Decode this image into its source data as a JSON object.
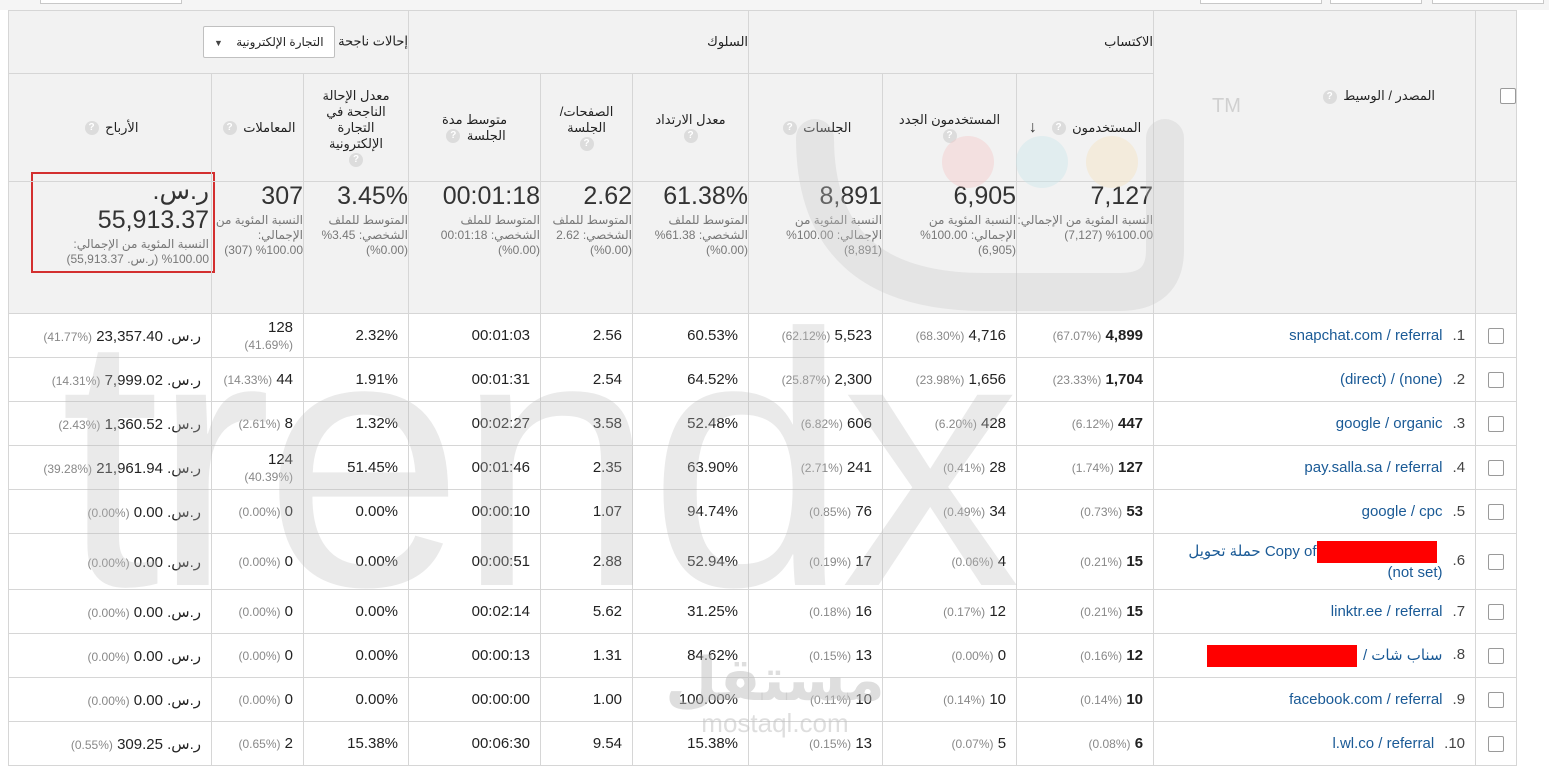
{
  "header": {
    "acquisition": "الاكتساب",
    "behavior": "السلوك",
    "conversions_label": "إحالات ناجحة",
    "ecommerce_dropdown": "التجارة الإلكترونية"
  },
  "columns": {
    "source": "المصدر / الوسيط",
    "users": "المستخدمون",
    "new_users": "المستخدمون الجدد",
    "sessions": "الجلسات",
    "bounce": "معدل الارتداد",
    "pages": "الصفحات/ الجلسة",
    "duration": "متوسط مدة الجلسة",
    "conv_rate": "معدل الإحالة الناجحة في التجارة الإلكترونية",
    "transactions": "المعاملات",
    "revenue": "الأرباح"
  },
  "totals": {
    "users": {
      "value": "7,127",
      "sub": "النسبة المئوية من الإجمالي: 100.00% (7,127)"
    },
    "new_users": {
      "value": "6,905",
      "sub": "النسبة المئوية من الإجمالي: 100.00% (6,905)"
    },
    "sessions": {
      "value": "8,891",
      "sub": "النسبة المئوية من الإجمالي: 100.00% (8,891)"
    },
    "bounce": {
      "value": "61.38%",
      "sub": "المتوسط للملف الشخصي: 61.38% (0.00%)"
    },
    "pages": {
      "value": "2.62",
      "sub": "المتوسط للملف الشخصي: 2.62 (0.00%)"
    },
    "duration": {
      "value": "00:01:18",
      "sub": "المتوسط للملف الشخصي: 00:01:18 (0.00%)"
    },
    "conv_rate": {
      "value": "3.45%",
      "sub": "المتوسط للملف الشخصي: 3.45% (0.00%)"
    },
    "transactions": {
      "value": "307",
      "sub": "النسبة المئوية من الإجمالي: 100.00% (307)"
    },
    "revenue": {
      "value": "ر.س. 55,913.37",
      "sub": "النسبة المئوية من الإجمالي: 100.00% (ر.س. 55,913.37)"
    }
  },
  "rows": [
    {
      "idx": "1.",
      "src": "snapchat.com / referral",
      "users": "4,899",
      "users_pct": "(67.07%)",
      "new": "4,716",
      "new_pct": "(68.30%)",
      "sess": "5,523",
      "sess_pct": "(62.12%)",
      "bounce": "60.53%",
      "pages": "2.56",
      "dur": "00:01:03",
      "conv": "2.32%",
      "tx": "128",
      "tx_pct": "(41.69%)",
      "rev": "ر.س. 23,357.40",
      "rev_pct": "(41.77%)"
    },
    {
      "idx": "2.",
      "src": "(none) / (direct)",
      "users": "1,704",
      "users_pct": "(23.33%)",
      "new": "1,656",
      "new_pct": "(23.98%)",
      "sess": "2,300",
      "sess_pct": "(25.87%)",
      "bounce": "64.52%",
      "pages": "2.54",
      "dur": "00:01:31",
      "conv": "1.91%",
      "tx": "44",
      "tx_pct": "(14.33%)",
      "rev": "ر.س. 7,999.02",
      "rev_pct": "(14.31%)"
    },
    {
      "idx": "3.",
      "src": "google / organic",
      "users": "447",
      "users_pct": "(6.12%)",
      "new": "428",
      "new_pct": "(6.20%)",
      "sess": "606",
      "sess_pct": "(6.82%)",
      "bounce": "52.48%",
      "pages": "3.58",
      "dur": "00:02:27",
      "conv": "1.32%",
      "tx": "8",
      "tx_pct": "(2.61%)",
      "rev": "ر.س. 1,360.52",
      "rev_pct": "(2.43%)"
    },
    {
      "idx": "4.",
      "src": "pay.salla.sa / referral",
      "users": "127",
      "users_pct": "(1.74%)",
      "new": "28",
      "new_pct": "(0.41%)",
      "sess": "241",
      "sess_pct": "(2.71%)",
      "bounce": "63.90%",
      "pages": "2.35",
      "dur": "00:01:46",
      "conv": "51.45%",
      "tx": "124",
      "tx_pct": "(40.39%)",
      "rev": "ر.س. 21,961.94",
      "rev_pct": "(39.28%)"
    },
    {
      "idx": "5.",
      "src": "google / cpc",
      "users": "53",
      "users_pct": "(0.73%)",
      "new": "34",
      "new_pct": "(0.49%)",
      "sess": "76",
      "sess_pct": "(0.85%)",
      "bounce": "94.74%",
      "pages": "1.07",
      "dur": "00:00:10",
      "conv": "0.00%",
      "tx": "0",
      "tx_pct": "(0.00%)",
      "rev": "ر.س. 0.00",
      "rev_pct": "(0.00%)"
    },
    {
      "idx": "6.",
      "src": "Copy of حملة تحويل",
      "src2": "(not set)",
      "users": "15",
      "users_pct": "(0.21%)",
      "new": "4",
      "new_pct": "(0.06%)",
      "sess": "17",
      "sess_pct": "(0.19%)",
      "bounce": "52.94%",
      "pages": "2.88",
      "dur": "00:00:51",
      "conv": "0.00%",
      "tx": "0",
      "tx_pct": "(0.00%)",
      "rev": "ر.س. 0.00",
      "rev_pct": "(0.00%)"
    },
    {
      "idx": "7.",
      "src": "linktr.ee / referral",
      "users": "15",
      "users_pct": "(0.21%)",
      "new": "12",
      "new_pct": "(0.17%)",
      "sess": "16",
      "sess_pct": "(0.18%)",
      "bounce": "31.25%",
      "pages": "5.62",
      "dur": "00:02:14",
      "conv": "0.00%",
      "tx": "0",
      "tx_pct": "(0.00%)",
      "rev": "ر.س. 0.00",
      "rev_pct": "(0.00%)"
    },
    {
      "idx": "8.",
      "src": "سناب شات /",
      "users": "12",
      "users_pct": "(0.16%)",
      "new": "0",
      "new_pct": "(0.00%)",
      "sess": "13",
      "sess_pct": "(0.15%)",
      "bounce": "84.62%",
      "pages": "1.31",
      "dur": "00:00:13",
      "conv": "0.00%",
      "tx": "0",
      "tx_pct": "(0.00%)",
      "rev": "ر.س. 0.00",
      "rev_pct": "(0.00%)"
    },
    {
      "idx": "9.",
      "src": "facebook.com / referral",
      "users": "10",
      "users_pct": "(0.14%)",
      "new": "10",
      "new_pct": "(0.14%)",
      "sess": "10",
      "sess_pct": "(0.11%)",
      "bounce": "100.00%",
      "pages": "1.00",
      "dur": "00:00:00",
      "conv": "0.00%",
      "tx": "0",
      "tx_pct": "(0.00%)",
      "rev": "ر.س. 0.00",
      "rev_pct": "(0.00%)"
    },
    {
      "idx": "10.",
      "src": "l.wl.co / referral",
      "users": "6",
      "users_pct": "(0.08%)",
      "new": "5",
      "new_pct": "(0.07%)",
      "sess": "13",
      "sess_pct": "(0.15%)",
      "bounce": "15.38%",
      "pages": "9.54",
      "dur": "00:06:30",
      "conv": "15.38%",
      "tx": "2",
      "tx_pct": "(0.65%)",
      "rev": "ر.س. 309.25",
      "rev_pct": "(0.55%)"
    }
  ],
  "watermark": {
    "word": "trendx",
    "tm": "TM",
    "logo_ar": "مستقل",
    "logo_en": "mostaql.com",
    "colors": [
      "#d0d0d0",
      "#f4c6c6",
      "#c8e6ea",
      "#f3e3c0"
    ]
  },
  "colors": {
    "link": "#1a5a96",
    "highlight": "#d32f2f",
    "redaction": "#ff0000"
  }
}
